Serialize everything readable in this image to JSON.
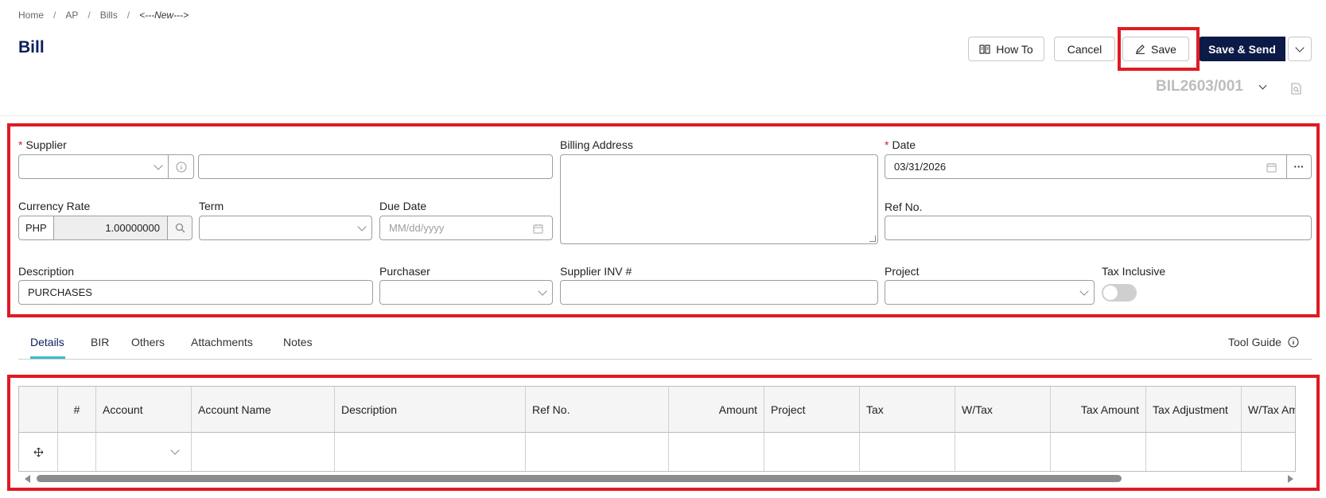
{
  "breadcrumb": {
    "home": "Home",
    "ap": "AP",
    "bills": "Bills",
    "current": "<---New--->"
  },
  "page_title": "Bill",
  "actions": {
    "how_to": "How To",
    "cancel": "Cancel",
    "save": "Save",
    "save_send": "Save & Send"
  },
  "document_number": "BIL2603/001",
  "form": {
    "supplier_label": "Supplier",
    "billing_address_label": "Billing Address",
    "date_label": "Date",
    "date_value": "03/31/2026",
    "currency_rate_label": "Currency Rate",
    "currency_code": "PHP",
    "currency_rate_value": "1.00000000",
    "term_label": "Term",
    "due_date_label": "Due Date",
    "due_date_placeholder": "MM/dd/yyyy",
    "ref_no_label": "Ref No.",
    "description_label": "Description",
    "description_value": "PURCHASES",
    "purchaser_label": "Purchaser",
    "supplier_inv_label": "Supplier INV #",
    "project_label": "Project",
    "tax_inclusive_label": "Tax Inclusive",
    "tax_inclusive_on": false,
    "more_glyph": "···"
  },
  "tabs": [
    "Details",
    "BIR",
    "Others",
    "Attachments",
    "Notes"
  ],
  "active_tab": "Details",
  "tool_guide": "Tool Guide",
  "grid": {
    "columns": [
      "",
      "#",
      "Account",
      "Account Name",
      "Description",
      "Ref No.",
      "Amount",
      "Project",
      "Tax",
      "W/Tax",
      "Tax Amount",
      "Tax Adjustment",
      "W/Tax Amount"
    ]
  },
  "colors": {
    "accent": "#0b1a47",
    "highlight": "#e01a24",
    "tab_underline": "#3fb8c9"
  }
}
